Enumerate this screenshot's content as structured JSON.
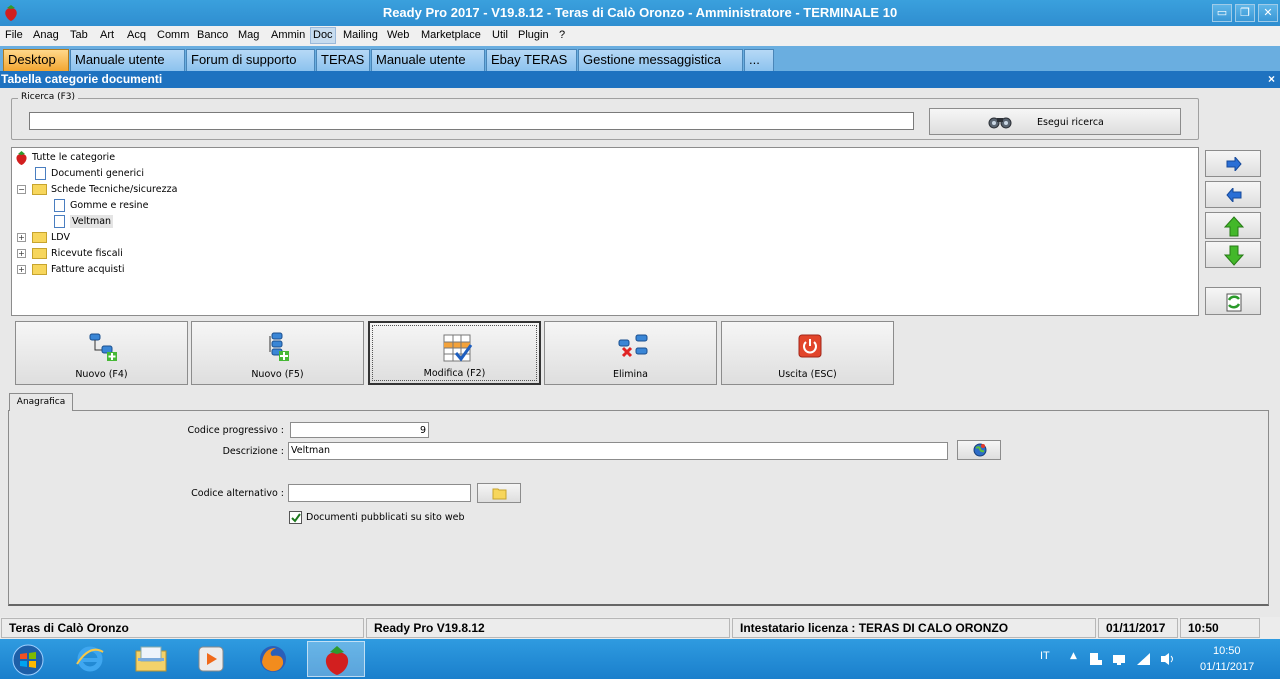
{
  "window": {
    "title": "Ready Pro 2017 - V19.8.12 - Teras di Calò Oronzo - Amministratore - TERMINALE 10",
    "minimize": "▭",
    "restore": "❐",
    "close": "✕"
  },
  "menu": [
    "File",
    "Anag",
    "Tab",
    "Art",
    "Acq",
    "Comm",
    "Banco",
    "Mag",
    "Ammin",
    "Doc",
    "Mailing",
    "Web",
    "Marketplace",
    "Util",
    "Plugin",
    "?"
  ],
  "tabs": [
    "Desktop",
    "Manuale utente",
    "Forum di supporto",
    "TERAS",
    "Manuale utente",
    "Ebay TERAS",
    "Gestione messaggistica",
    "..."
  ],
  "panel": {
    "title": "Tabella categorie documenti",
    "close": "×"
  },
  "search": {
    "legend": "Ricerca (F3)",
    "value": "",
    "button": "Esegui ricerca"
  },
  "tree": {
    "root": "Tutte le categorie",
    "items": [
      "Documenti generici",
      "Schede Tecniche/sicurezza",
      "Gomme e resine",
      "Veltman",
      "LDV",
      "Ricevute fiscali",
      "Fatture acquisti"
    ],
    "expander_collapsed": "+",
    "expander_expanded": "−"
  },
  "actions": {
    "new_f4": "Nuovo (F4)",
    "new_f5": "Nuovo (F5)",
    "modify": "Modifica (F2)",
    "delete": "Elimina",
    "exit": "Uscita (ESC)"
  },
  "form": {
    "tab": "Anagrafica",
    "codice_label": "Codice progressivo :",
    "codice_value": "9",
    "descrizione_label": "Descrizione :",
    "descrizione_value": "Veltman",
    "alternativo_label": "Codice alternativo :",
    "alternativo_value": "",
    "published_label": "Documenti pubblicati su sito web",
    "published_checked": true
  },
  "status": {
    "company": "Teras di Calò Oronzo",
    "version": "Ready Pro V19.8.12",
    "license": "Intestatario licenza : TERAS DI CALO ORONZO",
    "date": "01/11/2017",
    "time": "10:50"
  },
  "taskbar": {
    "lang": "IT",
    "time": "10:50",
    "date": "01/11/2017"
  },
  "colors": {
    "title_bar": "#2f8ed0",
    "panel_header": "#1e72c0",
    "active_tab": "#f2a632",
    "arrow_blue": "#2a6fd6",
    "arrow_green": "#43b82a"
  }
}
